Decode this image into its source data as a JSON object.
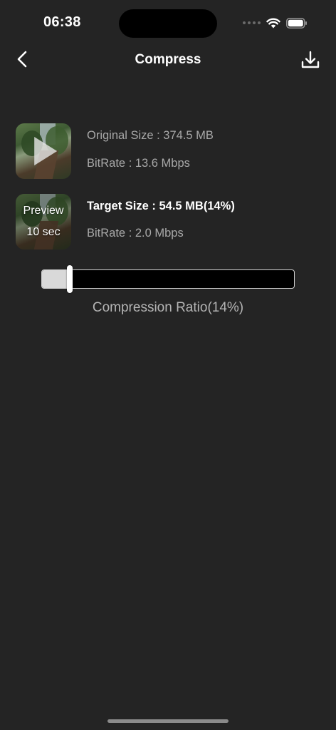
{
  "status_bar": {
    "time": "06:38",
    "icons": [
      "signal-dots-icon",
      "wifi-icon",
      "battery-icon"
    ]
  },
  "nav": {
    "title": "Compress",
    "back_icon": "chevron-left-icon",
    "download_icon": "download-icon"
  },
  "original": {
    "size_text": "Original Size : 374.5 MB",
    "bitrate_text": "BitRate : 13.6 Mbps",
    "thumbnail_icon": "play-icon"
  },
  "target": {
    "size_text": "Target Size : 54.5 MB(14%)",
    "bitrate_text": "BitRate : 2.0 Mbps",
    "preview_label": "Preview",
    "preview_duration": "10 sec"
  },
  "compression": {
    "ratio_label": "Compression Ratio(14%)",
    "ratio_value": 0.11
  },
  "colors": {
    "background": "#242424",
    "slider_track": "#000000",
    "slider_fill": "#d9d9d9"
  }
}
